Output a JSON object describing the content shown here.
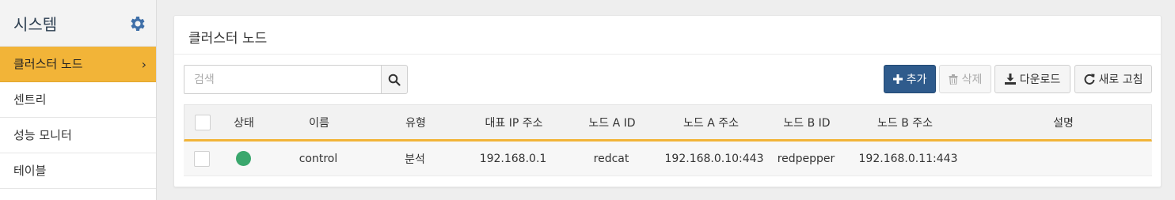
{
  "sidebar": {
    "title": "시스템",
    "items": [
      {
        "label": "클러스터 노드",
        "active": true
      },
      {
        "label": "센트리"
      },
      {
        "label": "성능 모니터"
      },
      {
        "label": "테이블"
      }
    ]
  },
  "panel": {
    "title": "클러스터 노드"
  },
  "search": {
    "placeholder": "검색"
  },
  "toolbar": {
    "add_label": "추가",
    "delete_label": "삭제",
    "download_label": "다운로드",
    "refresh_label": "새로 고침"
  },
  "table": {
    "columns": [
      "상태",
      "이름",
      "유형",
      "대표 IP 주소",
      "노드 A ID",
      "노드 A 주소",
      "노드 B ID",
      "노드 B 주소",
      "설명"
    ],
    "rows": [
      {
        "status": "green",
        "name": "control",
        "type": "분석",
        "ip": "192.168.0.1",
        "node_a_id": "redcat",
        "node_a_addr": "192.168.0.10:443",
        "node_b_id": "redpepper",
        "node_b_addr": "192.168.0.11:443",
        "description": ""
      }
    ]
  },
  "colors": {
    "accent": "#f2b438",
    "primary": "#2f5b8c",
    "status_ok": "#3aa76d"
  }
}
